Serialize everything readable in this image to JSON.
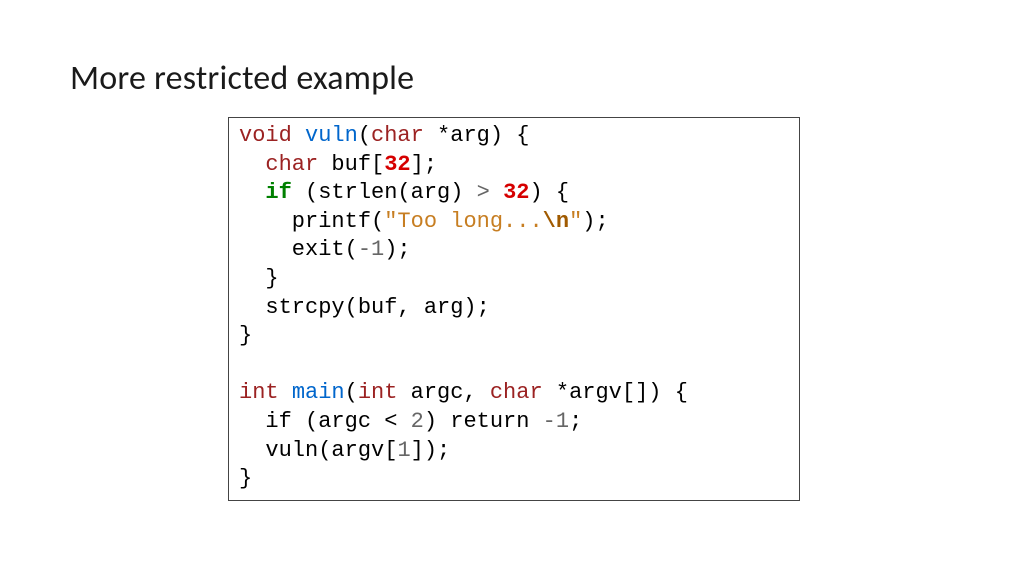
{
  "title": "More restricted example",
  "code": {
    "l1": {
      "t_void": "void",
      "sp1": " ",
      "fn": "vuln",
      "open": "(",
      "t_char": "char",
      "sp2": " *",
      "arg": "arg",
      "close": ") {"
    },
    "l2": {
      "indent": "  ",
      "t_char": "char",
      "sp": " ",
      "var": "buf[",
      "n32": "32",
      "end": "];"
    },
    "l3": {
      "indent": "  ",
      "kw_if": "if",
      "sp": " (strlen(arg) ",
      "gt": ">",
      "sp2": " ",
      "n32": "32",
      "end": ") {"
    },
    "l4": {
      "indent": "    printf(",
      "q1": "\"Too long...",
      "esc": "\\n",
      "q2": "\"",
      "end": ");"
    },
    "l5": {
      "indent": "    exit(",
      "neg1": "-1",
      "end": ");"
    },
    "l6": {
      "indent": "  }",
      "rest": ""
    },
    "l7": {
      "indent": "  strcpy(buf, arg);"
    },
    "l8": {
      "txt": "}"
    },
    "l9": {
      "txt": ""
    },
    "l10": {
      "t_int": "int",
      "sp1": " ",
      "fn": "main",
      "open": "(",
      "t_int2": "int",
      "sp2": " argc, ",
      "t_char": "char",
      "sp3": " *argv[]) {"
    },
    "l11": {
      "indent": "  if (argc < ",
      "n2": "2",
      "mid": ") return ",
      "neg1": "-1",
      "end": ";"
    },
    "l12": {
      "indent": "  vuln(argv[",
      "n1": "1",
      "end": "]);"
    },
    "l13": {
      "txt": "}"
    }
  }
}
